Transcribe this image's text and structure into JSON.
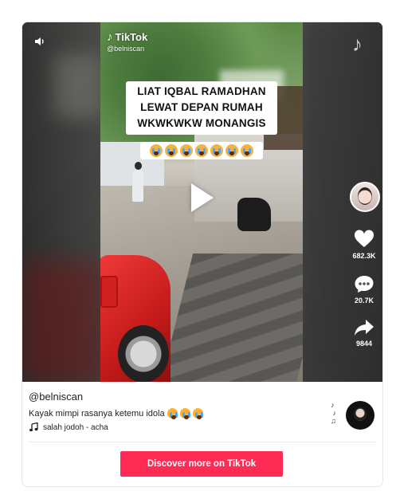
{
  "video": {
    "brand": "TikTok",
    "watermark_handle": "@belniscan",
    "caption_lines": [
      "LIAT IQBAL RAMADHAN",
      "LEWAT DEPAN RUMAH",
      "WKWKWKW MONANGIS"
    ],
    "caption_emoji_count": 7,
    "play_state": "paused"
  },
  "actions": {
    "likes": "682.3K",
    "comments": "20.7K",
    "shares": "9844"
  },
  "post": {
    "author": "@belniscan",
    "description": "Kayak mimpi rasanya ketemu idola",
    "description_emoji_count": 3,
    "music": "salah jodoh - acha"
  },
  "cta": {
    "label": "Discover more on TikTok",
    "color": "#fe2c55"
  },
  "icons": [
    "speaker-icon",
    "tiktok-logo-icon",
    "play-icon",
    "heart-icon",
    "comment-icon",
    "share-icon",
    "music-note-icon",
    "avatar",
    "record-disc"
  ]
}
